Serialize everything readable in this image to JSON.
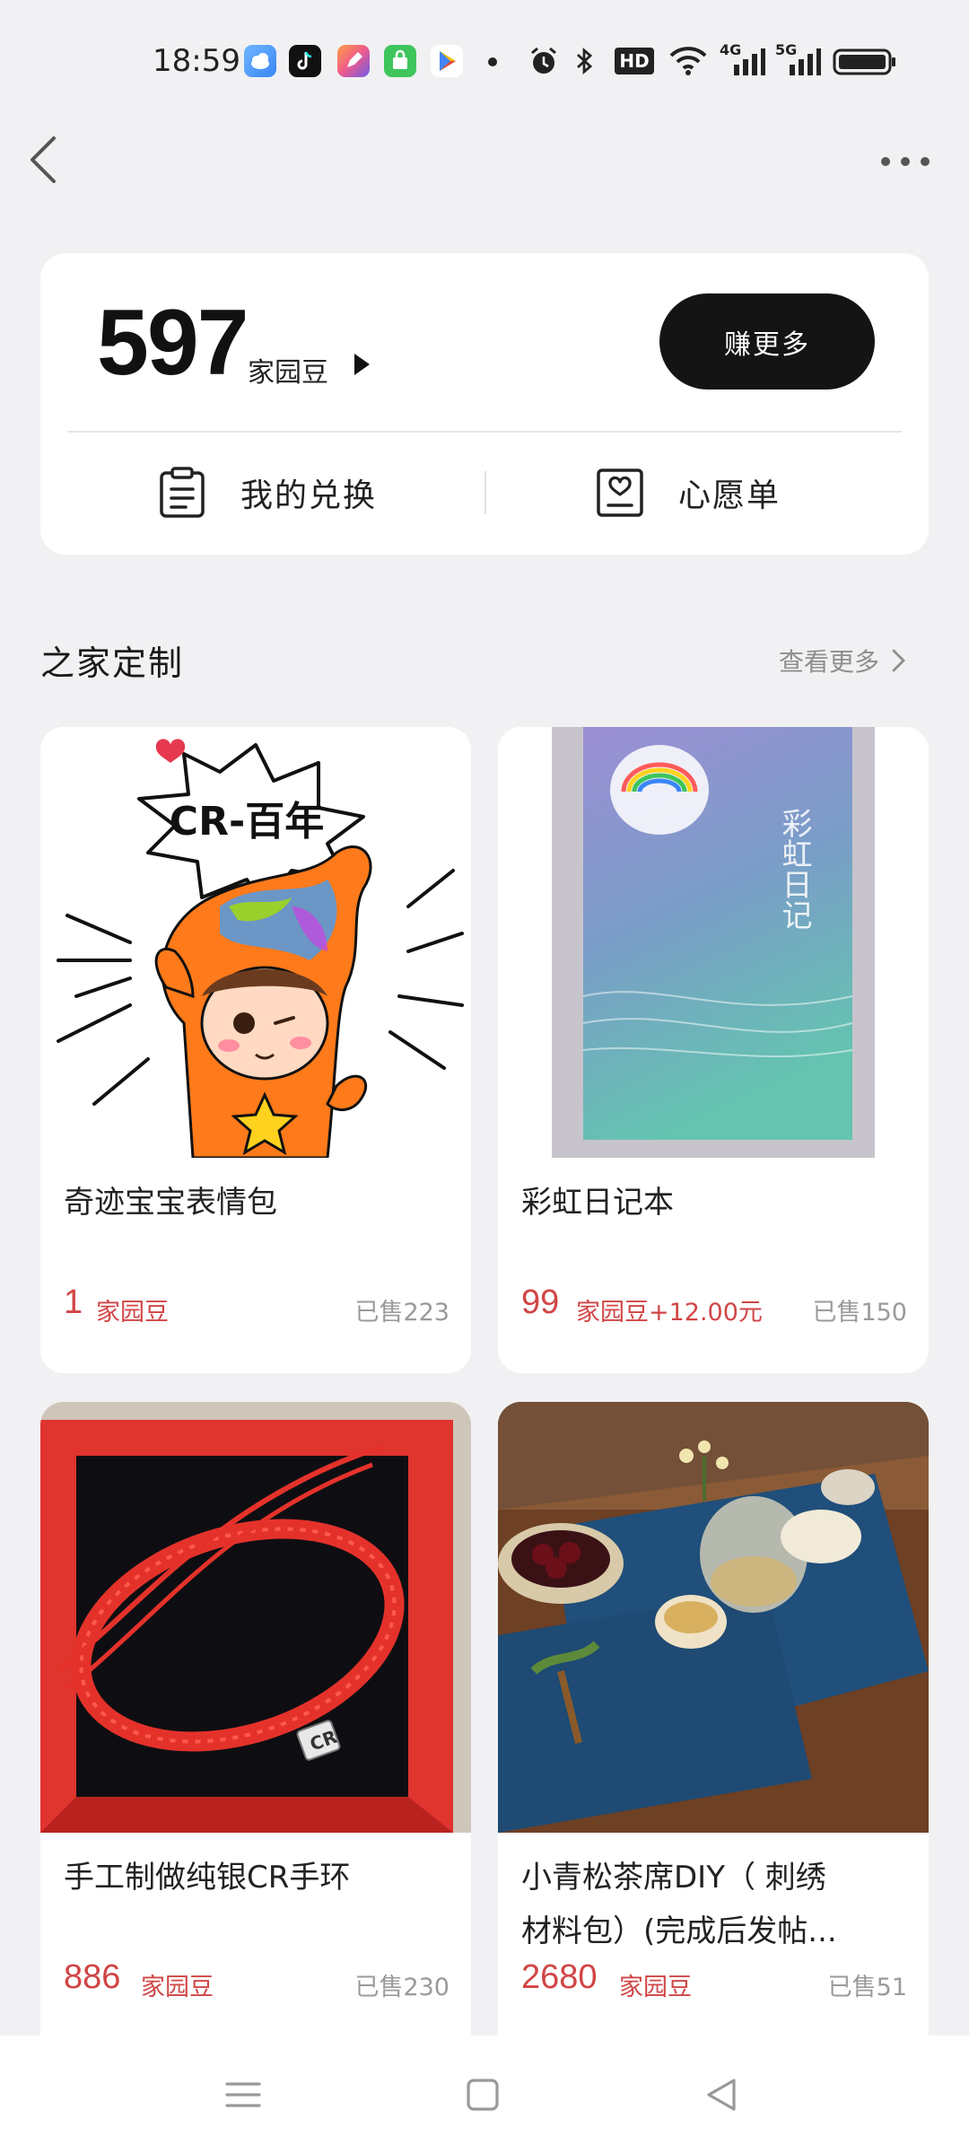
{
  "status_bar": {
    "time": "18:59",
    "network_badge": "HD",
    "net_4g": "4G",
    "net_5g": "5G"
  },
  "points": {
    "value": "597",
    "unit": "家园豆",
    "earn_button": "赚更多"
  },
  "quick_links": {
    "exchange": "我的兑换",
    "wishlist": "心愿单"
  },
  "section": {
    "title": "之家定制",
    "see_more": "查看更多"
  },
  "products": [
    {
      "name": "奇迹宝宝表情包",
      "price": "1",
      "unit": "家园豆",
      "sold": "已售223",
      "sticker_text": "CR-百年"
    },
    {
      "name": "彩虹日记本",
      "price": "99",
      "unit": "家园豆+12.00元",
      "sold": "已售150",
      "cover_title": "彩虹日记"
    },
    {
      "name": "手工制做纯银CR手环",
      "price": "886",
      "unit": "家园豆",
      "sold": "已售230",
      "charm_text": "CR"
    },
    {
      "name": "小青松茶席DIY（刺绣材料包）(完成后发帖...",
      "name_line1": "小青松茶席DIY（ 刺绣",
      "name_line2": "材料包）(完成后发帖...",
      "price": "2680",
      "unit": "家园豆",
      "sold": "已售51"
    }
  ],
  "colors": {
    "background": "#f1f1f3",
    "price_red": "#d14545",
    "button_dark": "#141414"
  }
}
